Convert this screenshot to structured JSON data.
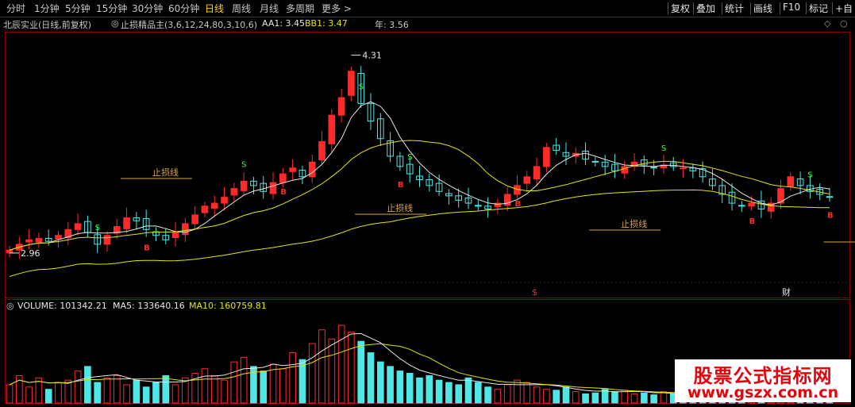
{
  "toolbar": {
    "periods": [
      "分时",
      "1分钟",
      "5分钟",
      "15分钟",
      "30分钟",
      "60分钟",
      "日线",
      "周线",
      "月线",
      "多周期",
      "更多 >"
    ],
    "active_period": "日线",
    "tools": [
      "复权",
      "叠加",
      "统计",
      "画线",
      "F10",
      "标记",
      "+自"
    ]
  },
  "info": {
    "stock": "北辰实业(日线,前复权)",
    "indicator": "止损精品主(3,6,12,24,80,3,10,6)",
    "aa1": "AA1: 3.45",
    "bb1": "BB1: 3.47",
    "year": "年: 3.56"
  },
  "price": {
    "high_label": "4.31",
    "low_label": "2.96",
    "stop_loss_label": "止损线",
    "sell_signal": "S",
    "buy_signal": "B",
    "events": [
      "$",
      "财"
    ]
  },
  "volume": {
    "volume_label": "VOLUME: 101342.21",
    "ma5_label": "MA5: 133640.16",
    "ma10_label": "MA10: 160759.81"
  },
  "watermark": {
    "line1": "股票公式指标网",
    "line2": "www.gszx.com.cn"
  },
  "colors": {
    "up": "#ff2a2a",
    "down": "#4fe6e6",
    "ma_white": "#e8e8e8",
    "ma_yellow": "#e6e600",
    "signal_green": "#3cff3c",
    "active": "#ffd200"
  },
  "chart_data": {
    "type": "candlestick",
    "price_high": 4.31,
    "price_low": 2.96,
    "values": [
      2.98,
      3.02,
      3.05,
      3.06,
      3.04,
      3.08,
      3.12,
      3.16,
      3.1,
      3.02,
      3.08,
      3.14,
      3.2,
      3.18,
      3.12,
      3.08,
      3.05,
      3.1,
      3.16,
      3.22,
      3.28,
      3.3,
      3.34,
      3.4,
      3.45,
      3.42,
      3.38,
      3.44,
      3.5,
      3.54,
      3.48,
      3.58,
      3.72,
      3.9,
      4.02,
      4.2,
      3.98,
      3.86,
      3.74,
      3.62,
      3.55,
      3.5,
      3.46,
      3.42,
      3.38,
      3.35,
      3.32,
      3.3,
      3.28,
      3.26,
      3.3,
      3.36,
      3.42,
      3.48,
      3.55,
      3.68,
      3.66,
      3.62,
      3.64,
      3.6,
      3.58,
      3.55,
      3.52,
      3.55,
      3.58,
      3.56,
      3.54,
      3.56,
      3.55,
      3.54,
      3.52,
      3.48,
      3.42,
      3.36,
      3.3,
      3.28,
      3.3,
      3.26,
      3.3,
      3.4,
      3.48,
      3.42,
      3.38,
      3.36,
      3.34
    ],
    "volumes": [
      40,
      60,
      35,
      55,
      30,
      45,
      50,
      70,
      80,
      45,
      55,
      60,
      40,
      50,
      35,
      45,
      60,
      40,
      55,
      65,
      75,
      60,
      50,
      90,
      100,
      80,
      70,
      85,
      75,
      110,
      95,
      130,
      160,
      140,
      170,
      155,
      135,
      110,
      90,
      80,
      70,
      65,
      55,
      60,
      50,
      45,
      40,
      55,
      45,
      35,
      30,
      40,
      50,
      45,
      35,
      30,
      28,
      35,
      25,
      20,
      22,
      30,
      25,
      28,
      20,
      22,
      18,
      25,
      20,
      18,
      22,
      15,
      14,
      16,
      12,
      14,
      20,
      30,
      35,
      25,
      20,
      18,
      16,
      14,
      12
    ],
    "volume_value": 101342.21,
    "ma5_value": 133640.16,
    "ma10_value": 160759.81
  }
}
